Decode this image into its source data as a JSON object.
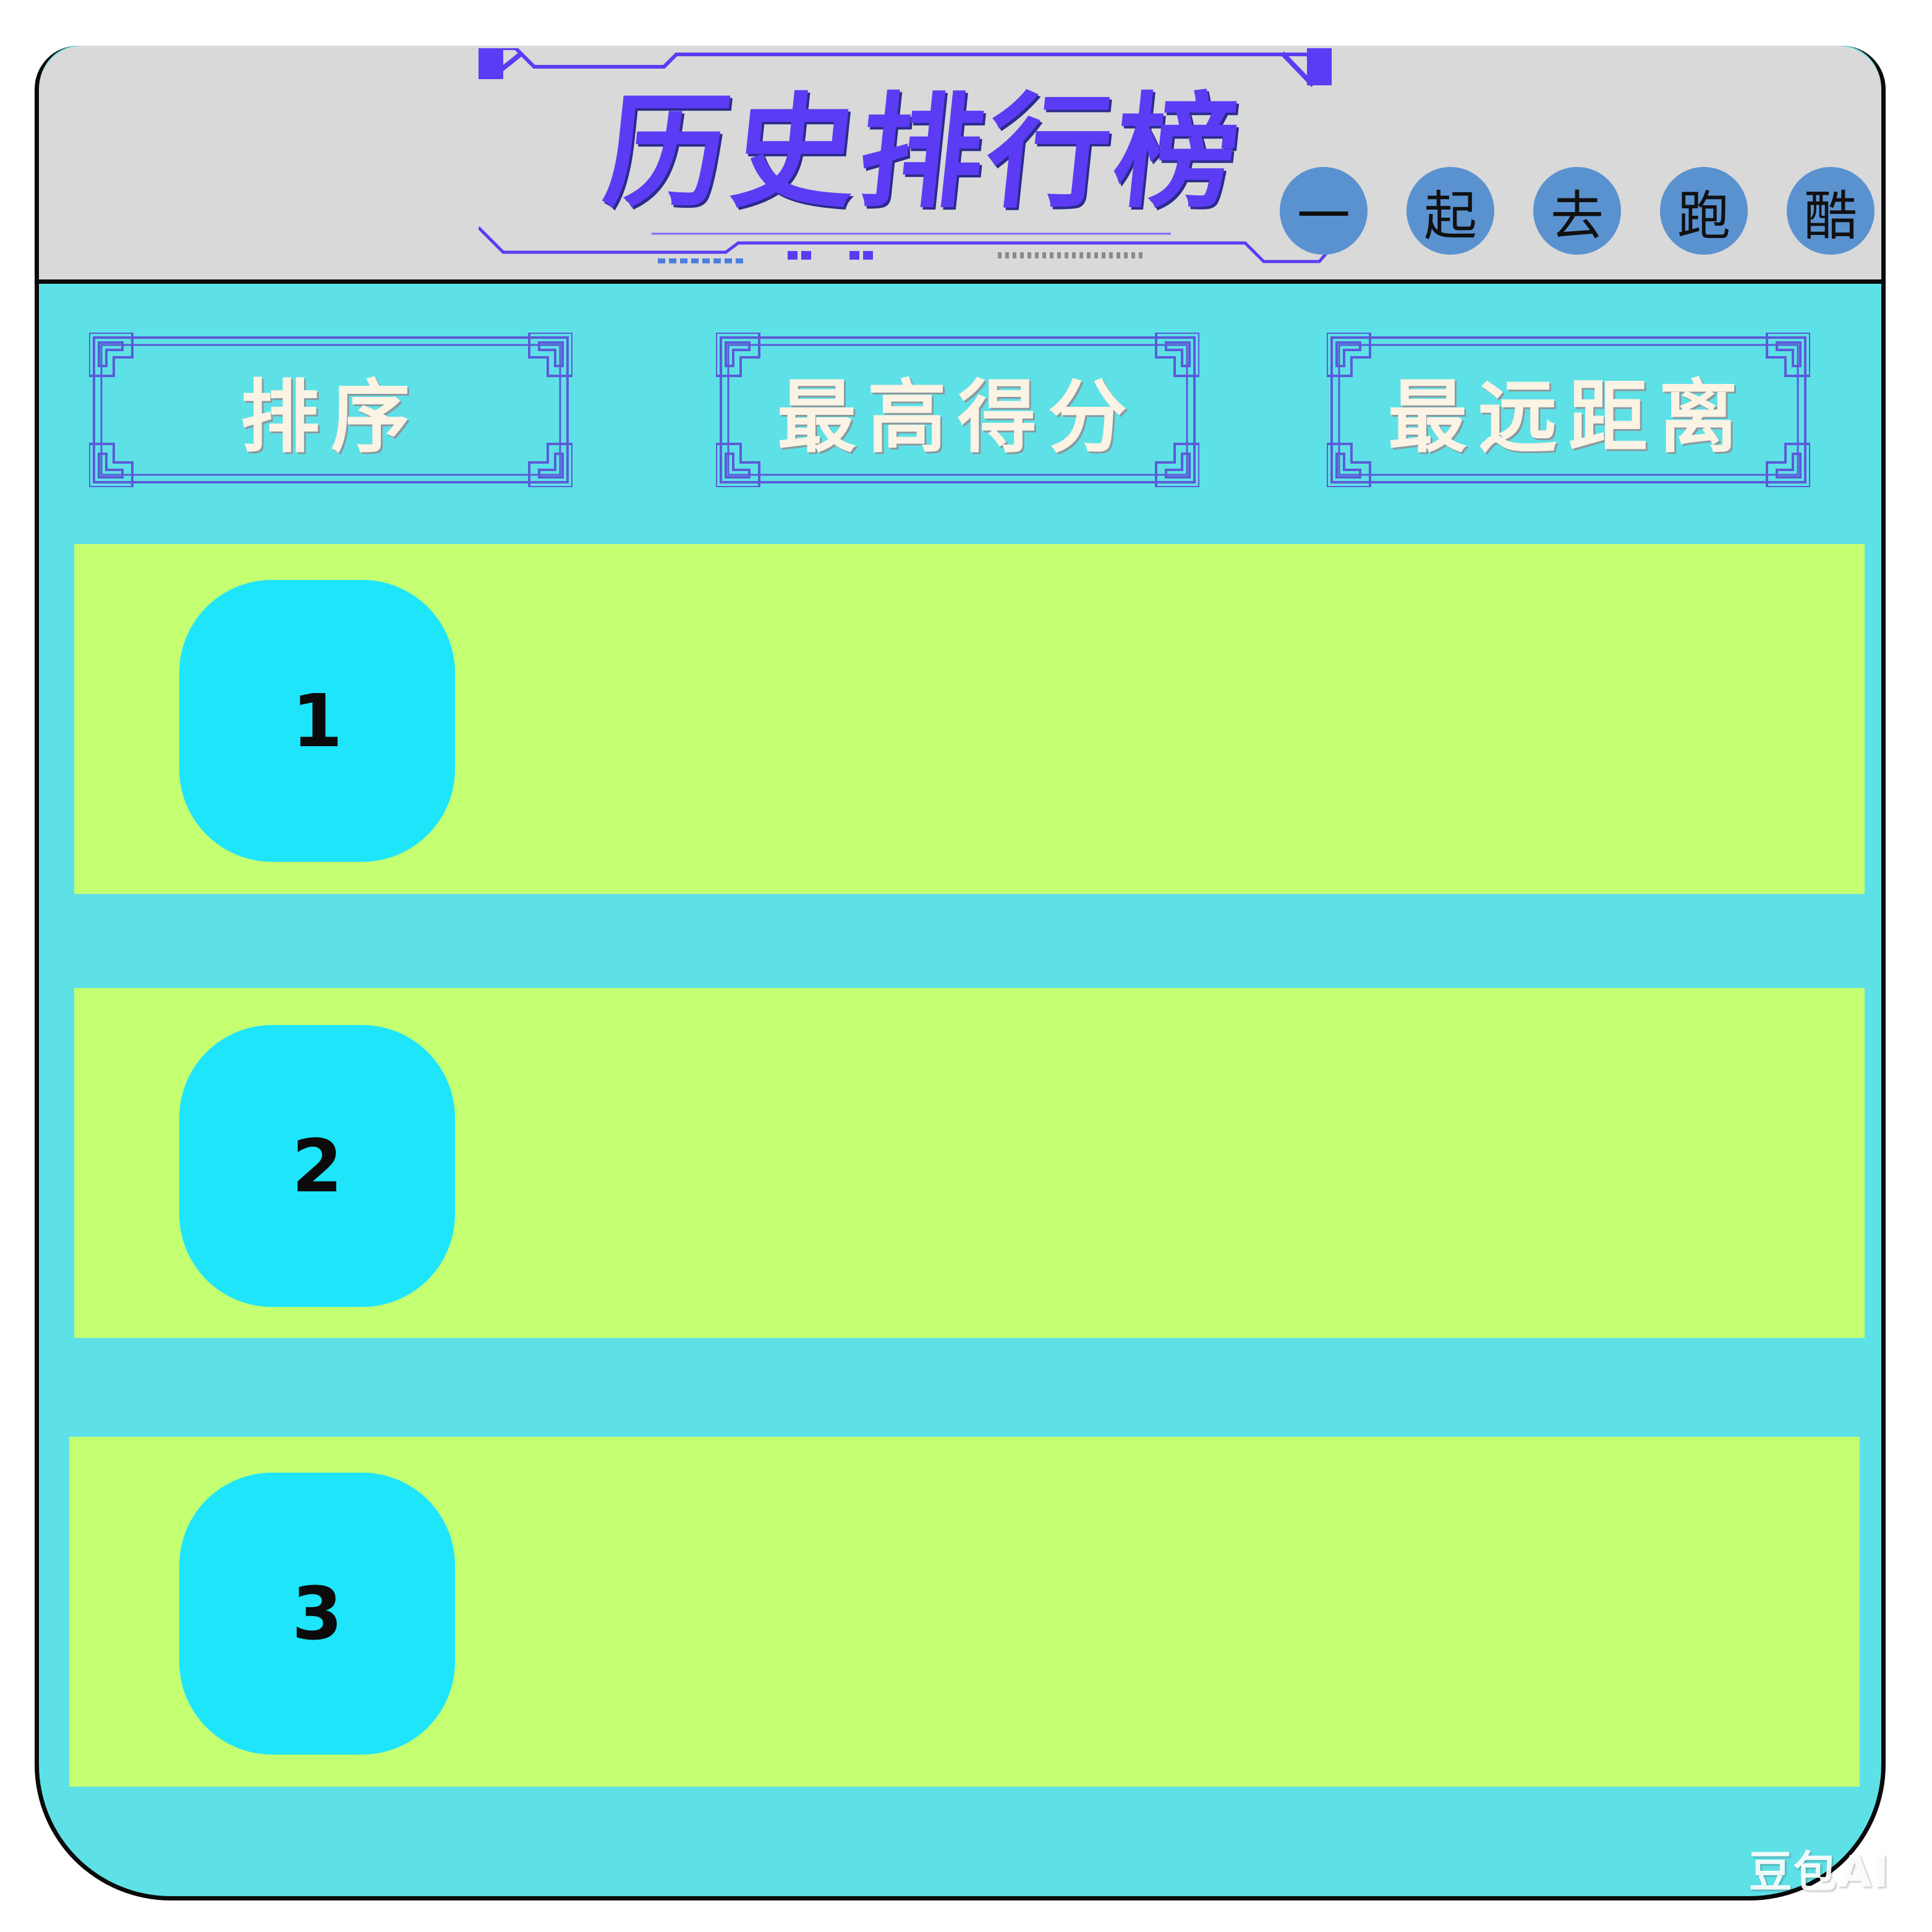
{
  "header": {
    "title": "历史排行榜",
    "badges": [
      "一",
      "起",
      "去",
      "跑",
      "酷"
    ]
  },
  "columns": [
    {
      "label": "排序"
    },
    {
      "label": "最高得分"
    },
    {
      "label": "最远距离"
    }
  ],
  "rows": [
    {
      "rank": "1"
    },
    {
      "rank": "2"
    },
    {
      "rank": "3"
    }
  ],
  "watermark": "豆包AI",
  "colors": {
    "panel": "#5ee1e6",
    "header_bar": "#d9d9d9",
    "title": "#5b3cf4",
    "badge": "#5a92d0",
    "row": "#c4ff72",
    "rank_box": "#1fe5fb"
  },
  "icons": [
    "ornate-frame",
    "tech-title-frame"
  ]
}
